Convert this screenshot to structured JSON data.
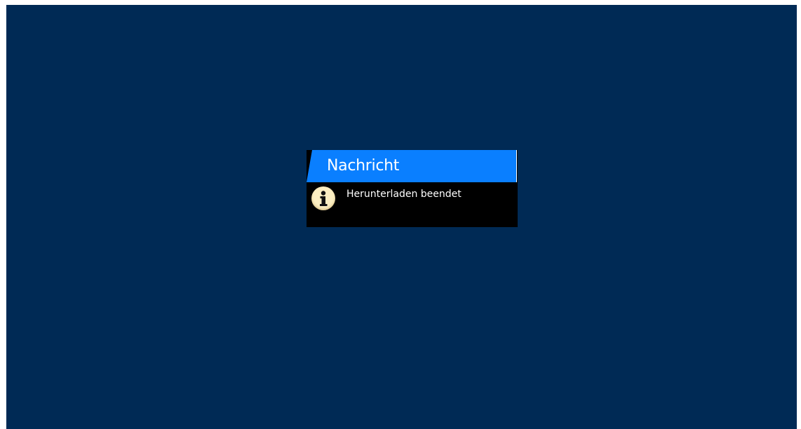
{
  "dialog": {
    "title": "Nachricht",
    "message": "Herunterladen beendet",
    "icon": "info-icon"
  },
  "colors": {
    "background": "#002a55",
    "title_bar": "#0a7fff",
    "dialog_body": "#000000",
    "icon_fill": "#fbeec2"
  }
}
